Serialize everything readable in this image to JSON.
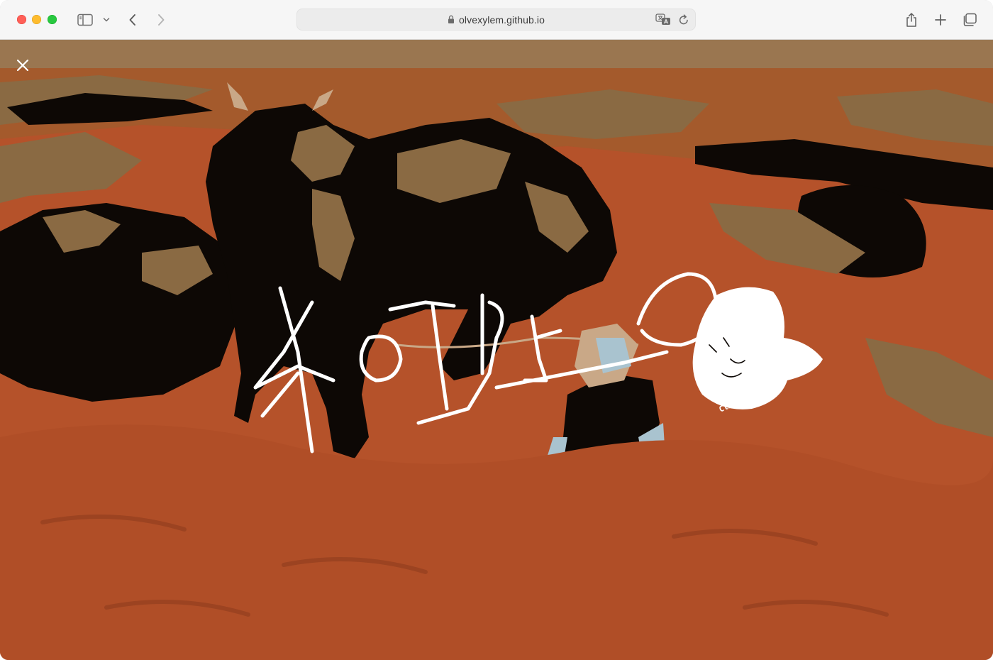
{
  "browser": {
    "url": "olvexylem.github.io"
  },
  "page": {
    "title_art": "RODEO",
    "hat_label": "Click me!"
  },
  "icons": {
    "sidebar": "sidebar-icon",
    "chevron": "chevron-down-icon",
    "back": "back-arrow-icon",
    "forward": "forward-arrow-icon",
    "lock": "lock-icon",
    "translate": "translate-icon",
    "reload": "reload-icon",
    "share": "share-icon",
    "new_tab": "plus-icon",
    "tabs": "tab-overview-icon",
    "close": "close-icon"
  },
  "colors": {
    "sand": "#b5522a",
    "dark": "#000000",
    "tan": "#8a6a43",
    "shirt": "#a9c3cf"
  }
}
